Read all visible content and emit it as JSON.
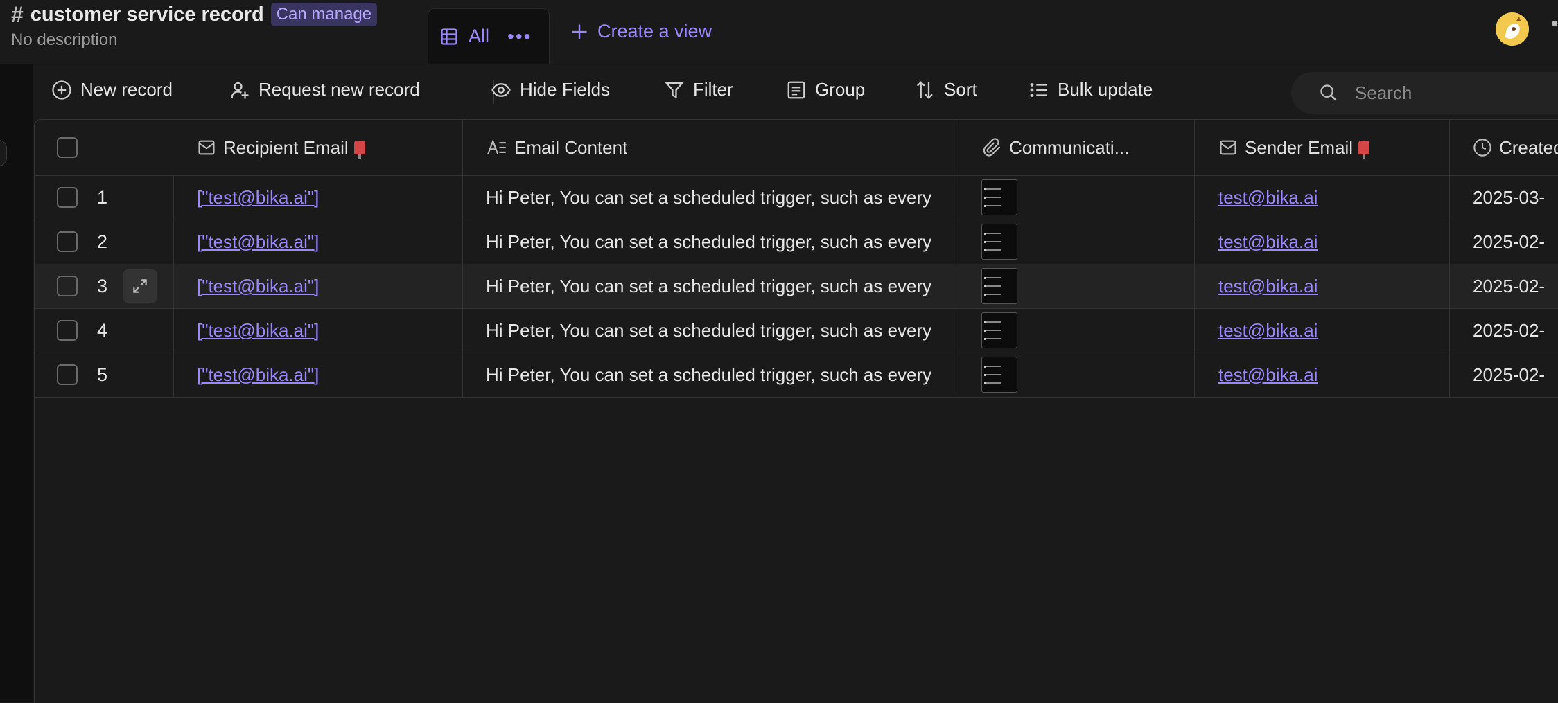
{
  "header": {
    "title": "customer service record",
    "permission_badge": "Can manage",
    "description": "No description",
    "view_tab": {
      "label": "All"
    },
    "create_view_label": "Create a view"
  },
  "toolbar": {
    "new_record": "New record",
    "request_new_record": "Request new record",
    "hide_fields": "Hide Fields",
    "filter": "Filter",
    "group": "Group",
    "sort": "Sort",
    "bulk_update": "Bulk update",
    "search_placeholder": "Search"
  },
  "table": {
    "columns": {
      "recipient_email": "Recipient Email",
      "email_content": "Email Content",
      "communication": "Communicati...",
      "sender_email": "Sender Email",
      "created": "Created"
    },
    "rows": [
      {
        "index": "1",
        "recipient": "[\"test@bika.ai\"]",
        "content": "Hi Peter, You can set a scheduled trigger, such as every",
        "sender": "test@bika.ai",
        "created": "2025-03-"
      },
      {
        "index": "2",
        "recipient": "[\"test@bika.ai\"]",
        "content": "Hi Peter, You can set a scheduled trigger, such as every",
        "sender": "test@bika.ai",
        "created": "2025-02-"
      },
      {
        "index": "3",
        "recipient": "[\"test@bika.ai\"]",
        "content": "Hi Peter, You can set a scheduled trigger, such as every",
        "sender": "test@bika.ai",
        "created": "2025-02-"
      },
      {
        "index": "4",
        "recipient": "[\"test@bika.ai\"]",
        "content": "Hi Peter, You can set a scheduled trigger, such as every",
        "sender": "test@bika.ai",
        "created": "2025-02-"
      },
      {
        "index": "5",
        "recipient": "[\"test@bika.ai\"]",
        "content": "Hi Peter, You can set a scheduled trigger, such as every",
        "sender": "test@bika.ai",
        "created": "2025-02-"
      }
    ]
  },
  "colors": {
    "accent": "#9b87ff",
    "background": "#1a1a1a",
    "grid_line": "#333333"
  }
}
